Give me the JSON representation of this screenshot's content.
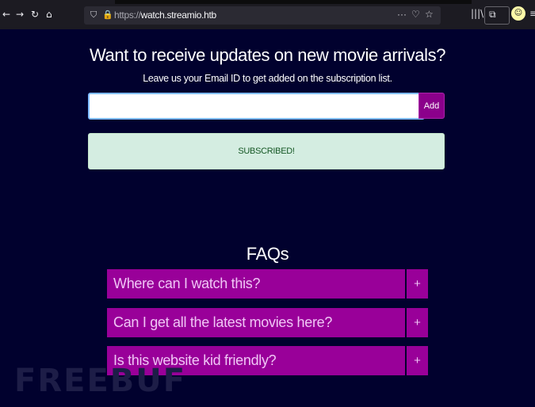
{
  "browser": {
    "url_prefix": "https://",
    "url_host": "watch.streamio.htb",
    "icons": {
      "back": "←",
      "forward": "→",
      "reload": "↻",
      "home": "⌂",
      "shield": "⛉",
      "lock": "🔒",
      "more": "···",
      "pocket": "♡",
      "bookmark": "☆",
      "library": "|||\\",
      "extensions": "⧉",
      "chat": "☺",
      "menu": "≡"
    }
  },
  "subscribe": {
    "heading": "Want to receive updates on new movie arrivals?",
    "subheading": "Leave us your Email ID to get added on the subscription list.",
    "email_value": "",
    "add_label": "Add",
    "status_message": "SUBSCRIBED!"
  },
  "faq": {
    "title": "FAQs",
    "items": [
      {
        "question": "Where can I watch this?",
        "toggle": "+"
      },
      {
        "question": "Can I get all the latest movies here?",
        "toggle": "+"
      },
      {
        "question": "Is this website kid friendly?",
        "toggle": "+"
      }
    ]
  },
  "watermark": "FREEBUF",
  "colors": {
    "page_bg": "#01012e",
    "accent": "#990099",
    "alert_bg": "#d4ede1"
  }
}
